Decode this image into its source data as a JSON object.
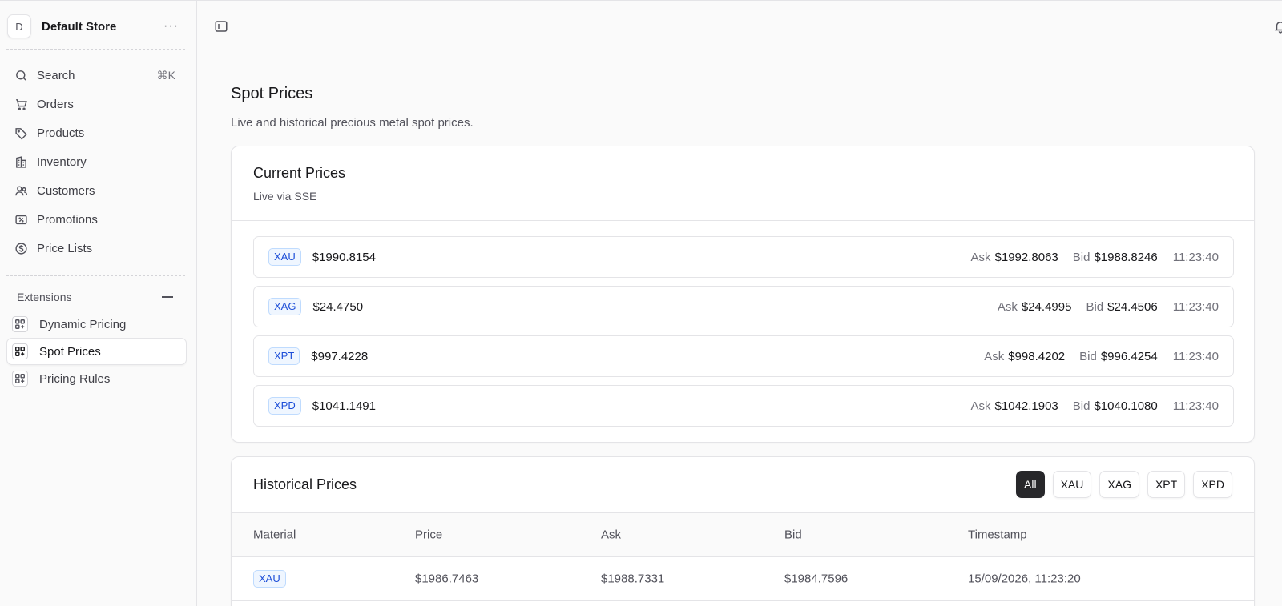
{
  "store": {
    "initial": "D",
    "name": "Default Store",
    "more": "···"
  },
  "nav": {
    "search": {
      "label": "Search",
      "shortcut": "⌘K"
    },
    "items": [
      {
        "label": "Orders",
        "icon": "cart-icon"
      },
      {
        "label": "Products",
        "icon": "tag-icon"
      },
      {
        "label": "Inventory",
        "icon": "building-icon"
      },
      {
        "label": "Customers",
        "icon": "users-icon"
      },
      {
        "label": "Promotions",
        "icon": "ticket-icon"
      },
      {
        "label": "Price Lists",
        "icon": "dollar-circle-icon"
      }
    ]
  },
  "extensions": {
    "header": "Extensions",
    "items": [
      {
        "label": "Dynamic Pricing",
        "active": false
      },
      {
        "label": "Spot Prices",
        "active": true
      },
      {
        "label": "Pricing Rules",
        "active": false
      }
    ]
  },
  "page": {
    "title": "Spot Prices",
    "subtitle": "Live and historical precious metal spot prices."
  },
  "current": {
    "title": "Current Prices",
    "subtitle": "Live via SSE",
    "ask_label": "Ask",
    "bid_label": "Bid",
    "rows": [
      {
        "metal": "XAU",
        "price": "$1990.8154",
        "ask": "$1992.8063",
        "bid": "$1988.8246",
        "time": "11:23:40"
      },
      {
        "metal": "XAG",
        "price": "$24.4750",
        "ask": "$24.4995",
        "bid": "$24.4506",
        "time": "11:23:40"
      },
      {
        "metal": "XPT",
        "price": "$997.4228",
        "ask": "$998.4202",
        "bid": "$996.4254",
        "time": "11:23:40"
      },
      {
        "metal": "XPD",
        "price": "$1041.1491",
        "ask": "$1042.1903",
        "bid": "$1040.1080",
        "time": "11:23:40"
      }
    ]
  },
  "historical": {
    "title": "Historical Prices",
    "filters": [
      "All",
      "XAU",
      "XAG",
      "XPT",
      "XPD"
    ],
    "active_filter": "All",
    "columns": [
      "Material",
      "Price",
      "Ask",
      "Bid",
      "Timestamp"
    ],
    "rows": [
      {
        "material": "XAU",
        "price": "$1986.7463",
        "ask": "$1988.7331",
        "bid": "$1984.7596",
        "timestamp": "15/09/2026, 11:23:20"
      }
    ]
  },
  "colors": {
    "badge_bg": "#eff6ff",
    "badge_text": "#1d4ed8",
    "active_filter_bg": "#27272a"
  }
}
